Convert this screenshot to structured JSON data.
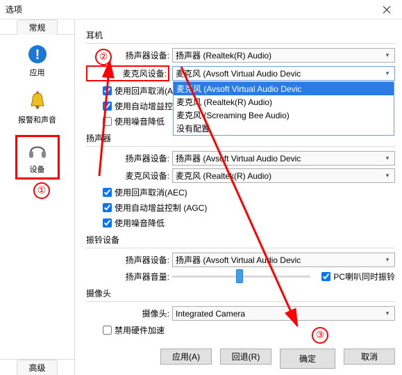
{
  "window": {
    "title": "选项",
    "close_icon": "close"
  },
  "sidebar": {
    "tab_general": "常规",
    "tab_advanced": "高级",
    "items": [
      {
        "icon": "info-circle",
        "label": "应用"
      },
      {
        "icon": "bell",
        "label": "报警和声音"
      },
      {
        "icon": "headset",
        "label": "设备"
      }
    ]
  },
  "groups": {
    "headset": {
      "title": "耳机",
      "speaker_label": "扬声器设备:",
      "speaker_value": "扬声器 (Realtek(R) Audio)",
      "mic_label": "麦克风设备:",
      "mic_value": "麦克风 (Avsoft Virtual Audio Devic",
      "mic_options": [
        "麦克风 (Avsoft Virtual Audio Devic",
        "麦克风 (Realtek(R) Audio)",
        "麦克风 (Screaming Bee Audio)",
        "没有配置"
      ],
      "chk_aec": "使用回声取消(AEC",
      "chk_agc": "使用自动增益控制",
      "chk_nr": "使用噪音降低"
    },
    "speaker": {
      "title": "扬声器",
      "speaker_label": "扬声器设备:",
      "speaker_value": "扬声器 (Avsoft Virtual Audio Devic",
      "mic_label": "麦克风设备:",
      "mic_value": "麦克风 (Realtek(R) Audio)",
      "chk_aec": "使用回声取消(AEC)",
      "chk_agc": "使用自动增益控制 (AGC)",
      "chk_nr": "使用噪音降低"
    },
    "ring": {
      "title": "振铃设备",
      "speaker_label": "扬声器设备:",
      "speaker_value": "扬声器 (Avsoft Virtual Audio Devic",
      "volume_label": "扬声器音量:",
      "pc_speaker_chk": "PC喇叭同时振铃"
    },
    "camera": {
      "title": "摄像头",
      "cam_label": "摄像头:",
      "cam_value": "Integrated Camera",
      "chk_hw": "禁用硬件加速"
    }
  },
  "buttons": {
    "apply": "应用(A)",
    "revert": "回退(R)",
    "ok": "确定",
    "cancel": "取消"
  },
  "annotations": {
    "n1": "①",
    "n2": "②",
    "n3": "③"
  }
}
